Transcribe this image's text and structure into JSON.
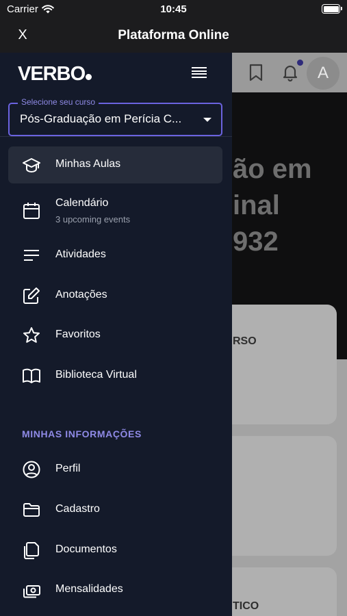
{
  "status_bar": {
    "carrier": "Carrier",
    "time": "10:45"
  },
  "nav": {
    "close_label": "X",
    "title": "Plataforma Online"
  },
  "drawer": {
    "logo": "VERBO",
    "course_select": {
      "legend": "Selecione seu curso",
      "value": "Pós-Graduação em Perícia C..."
    },
    "menu_items": [
      {
        "label": "Minhas Aulas",
        "icon": "graduation-cap-icon",
        "active": true
      },
      {
        "label": "Calendário",
        "sub": "3 upcoming events",
        "icon": "calendar-icon"
      },
      {
        "label": "Atividades",
        "icon": "list-icon"
      },
      {
        "label": "Anotações",
        "icon": "edit-note-icon"
      },
      {
        "label": "Favoritos",
        "icon": "star-icon"
      },
      {
        "label": "Biblioteca Virtual",
        "icon": "open-book-icon"
      }
    ],
    "section_title": "MINHAS INFORMAÇÕES",
    "info_items": [
      {
        "label": "Perfil",
        "icon": "user-circle-icon"
      },
      {
        "label": "Cadastro",
        "icon": "folder-icon"
      },
      {
        "label": "Documentos",
        "icon": "documents-icon"
      },
      {
        "label": "Mensalidades",
        "icon": "payments-icon"
      }
    ]
  },
  "background": {
    "avatar_initial": "A",
    "hero_lines": [
      "ão em",
      "inal",
      "932"
    ],
    "card_labels": [
      "RSO",
      "TICO"
    ]
  },
  "colors": {
    "drawer_bg": "#141a2a",
    "accent": "#8f8ae6",
    "active_bg": "#262c3a"
  }
}
